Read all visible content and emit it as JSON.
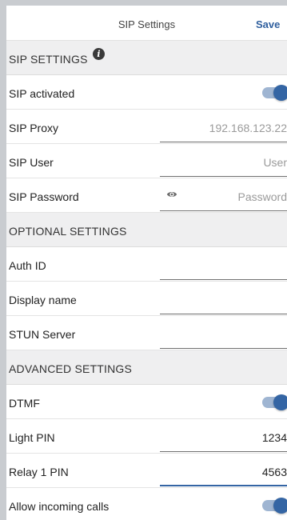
{
  "header": {
    "title": "SIP Settings",
    "save_label": "Save"
  },
  "sections": {
    "sip": {
      "label": "SIP SETTINGS",
      "info_icon": "info-icon"
    },
    "optional": {
      "label": "OPTIONAL SETTINGS"
    },
    "advanced": {
      "label": "ADVANCED SETTINGS"
    }
  },
  "sip": {
    "activated": {
      "label": "SIP activated",
      "on": true
    },
    "proxy": {
      "label": "SIP Proxy",
      "value": "192.168.123.22"
    },
    "user": {
      "label": "SIP User",
      "placeholder": "User"
    },
    "password": {
      "label": "SIP Password",
      "placeholder": "Password",
      "icon": "eye-icon"
    }
  },
  "optional": {
    "auth_id": {
      "label": "Auth ID",
      "value": ""
    },
    "display_name": {
      "label": "Display name",
      "value": ""
    },
    "stun_server": {
      "label": "STUN Server",
      "value": ""
    }
  },
  "advanced": {
    "dtmf": {
      "label": "DTMF",
      "on": true
    },
    "light_pin": {
      "label": "Light PIN",
      "value": "1234"
    },
    "relay1_pin": {
      "label": "Relay 1 PIN",
      "value": "4563"
    },
    "incoming_calls": {
      "label": "Allow incoming calls",
      "on": true
    }
  },
  "colors": {
    "accent": "#3465a4",
    "section_bg": "#efeff0",
    "screen_bg": "#c9ccd0"
  }
}
